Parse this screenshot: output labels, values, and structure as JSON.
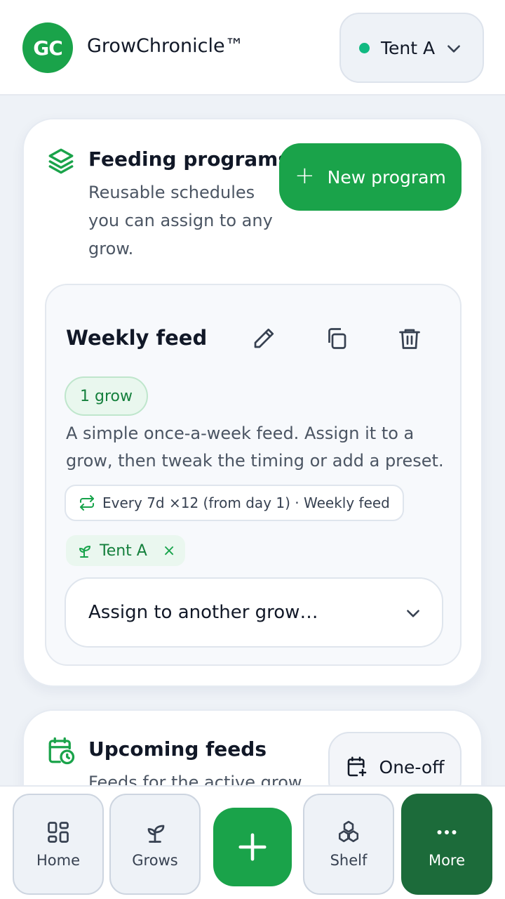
{
  "header": {
    "logo_text": "GC",
    "brand": "GrowChronicle™",
    "active_grow": "Tent A",
    "status_color": "#10b981"
  },
  "programs_section": {
    "title": "Feeding programs",
    "subtitle_lines": [
      "Reusable schedules",
      "you can assign to any",
      "grow."
    ],
    "new_button": "New program",
    "accent_color": "#1aa34a"
  },
  "program": {
    "name": "Weekly feed",
    "grow_count": "1 grow",
    "description_lines": [
      "A simple once-a-week feed. Assign it to a",
      "grow, then tweak the timing or add a preset."
    ],
    "schedule": "Every 7d ×12 (from day 1) · Weekly feed",
    "assigned_grow": "Tent A",
    "remove_symbol": "×",
    "assign_placeholder": "Assign to another grow…"
  },
  "upcoming_section": {
    "title": "Upcoming feeds",
    "subtitle": "Feeds for the active grow",
    "oneoff_button": "One-off"
  },
  "nav": {
    "home": "Home",
    "grows": "Grows",
    "shelf": "Shelf",
    "more": "More"
  }
}
